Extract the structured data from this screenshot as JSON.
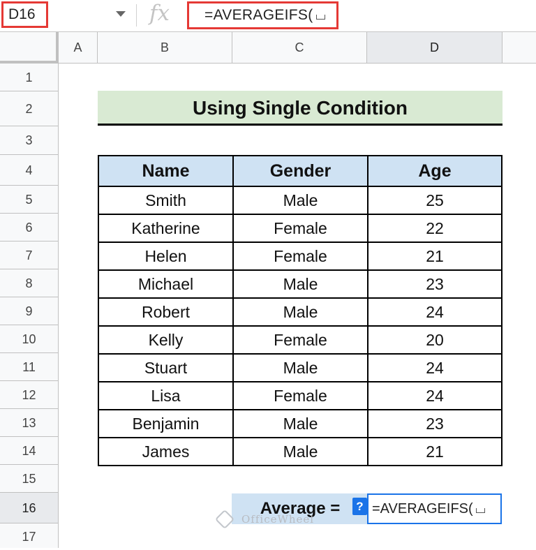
{
  "formula_bar": {
    "name_box": "D16",
    "fx_icon": "fx-icon",
    "formula": "=AVERAGEIFS("
  },
  "columns": [
    "A",
    "B",
    "C",
    "D"
  ],
  "rows": [
    "1",
    "2",
    "3",
    "4",
    "5",
    "6",
    "7",
    "8",
    "9",
    "10",
    "11",
    "12",
    "13",
    "14",
    "15",
    "16",
    "17"
  ],
  "sheet": {
    "title": "Using Single Condition",
    "headers": [
      "Name",
      "Gender",
      "Age"
    ],
    "data": [
      [
        "Smith",
        "Male",
        "25"
      ],
      [
        "Katherine",
        "Female",
        "22"
      ],
      [
        "Helen",
        "Female",
        "21"
      ],
      [
        "Michael",
        "Male",
        "23"
      ],
      [
        "Robert",
        "Male",
        "24"
      ],
      [
        "Kelly",
        "Female",
        "20"
      ],
      [
        "Stuart",
        "Male",
        "24"
      ],
      [
        "Lisa",
        "Female",
        "24"
      ],
      [
        "Benjamin",
        "Male",
        "23"
      ],
      [
        "James",
        "Male",
        "21"
      ]
    ],
    "average_label": "Average =",
    "help_icon": "?",
    "active_cell_formula": "=AVERAGEIFS("
  },
  "watermark": "OfficeWheel",
  "colors": {
    "highlight_border": "#e53935",
    "title_fill": "#d9ead3",
    "header_fill": "#cfe2f3",
    "active_cell_border": "#1a73e8"
  }
}
